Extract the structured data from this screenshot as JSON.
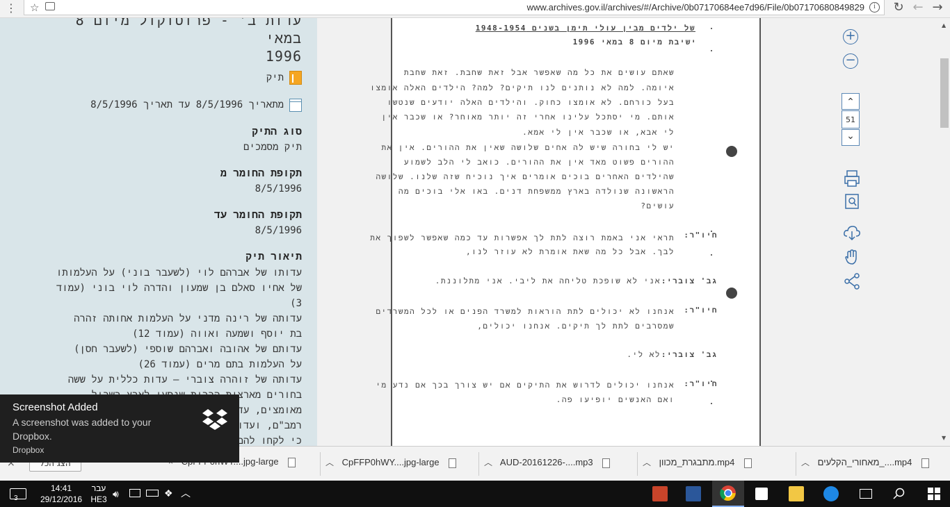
{
  "browser": {
    "url": "www.archives.gov.il/archives/#/Archive/0b07170684ee7d96/File/0b07170680849829",
    "menu_glyph": "⋮",
    "star_glyph": "☆",
    "info_glyph": "i",
    "reload_glyph": "↻",
    "back_glyph": "←",
    "forward_glyph": "→"
  },
  "left_panel": {
    "title_line1": "עדות ב' - פרוטוקול מיום 8 במאי",
    "title_line2": "1996",
    "type_label": "תיק",
    "date_range": "מתאריך 8/5/1996 עד תאריך 8/5/1996",
    "fields": [
      {
        "label": "סוג התיק",
        "value": "תיק מסמכים"
      },
      {
        "label": "תקופת החומר מ",
        "value": "8/5/1996"
      },
      {
        "label": "תקופת החומר עד",
        "value": "8/5/1996"
      }
    ],
    "description_label": "תיאור תיק",
    "description_lines": [
      "עדותו של אברהם לוי (לשעבר בוני) על העלמותו",
      "של אחיו סאלם בן שמעון והדרה לוי בוני (עמוד",
      "3)",
      "עדותה של רינה מדני על העלמות אחותה זהרה",
      "בת יוסף ושמעה ואווה (עמוד 12)",
      "עדותם של אהובה ואברהם שוספי (לשעבר חסן)",
      "על העלמות בתם מרים (עמוד 26)",
      "עדותה של זוהרה צוברי – עדות כללית על ששה",
      "בחורים מארצות הברית שנסעו לארץ בשביל",
      "מאומצים, עדות",
      "רמב\"ם, ועדות",
      "כי לקחו להם"
    ]
  },
  "document_page": {
    "header_line1": "של ילדים מבין עולי תימן בשנים 1948-1954",
    "header_line2": "ישיבת מיום 8 במאי 1996",
    "lines": [
      "שאתם עושים את כל מה שאפשר אבל זאת שחבת. זאת שחבת",
      "איומה. למה לא נותנים לנו תיקים? למה? הילדים האלה אומצו",
      "בעל כורחם. לא אומצו כחוק. והילדים האלה יודעים שנטשו",
      "אותם. מי יסתכל עלינו אחרי זה יותר מאוחר? או שכבר אין",
      "לי אבא, או שכבר אין לי אמא.",
      "יש לי בחורה שיש לה אחים שלושה שאין את ההורים. אין את",
      "ההורים פשוט מאד אין את ההורים. כואב לי הלב לשמוע",
      "שהילדים האחרים בוכים אומרים איך נוכיח שזה שלנו. שלושה",
      "הראשונה שנולדה בארץ ממשפחת דנים. באו אלי בוכים מה",
      "עושים?"
    ],
    "speaker1": "חיו\"ר:",
    "speaker1_line1": "תראי אני באמת רוצה לתת לך אפשרות עד כמה שאפשר לשפוך את",
    "speaker1_line2": "לבך. אבל כל מה שאת אומרת לא עוזר לנו,",
    "speaker2": "גב' צוברי:",
    "speaker2_line1": "אני לא שופכת טליחה את ליבי. אני מתלוננת.",
    "speaker3": "חיו\"ר:",
    "speaker3_line1": "אנחנו לא יכולים לתת הוראות למשרד הפנים או לכל המשרדים",
    "speaker3_line2": "שמסרבים לתת לך תיקים. אנחנו יכולים,",
    "speaker4": "גב' צוברי:",
    "speaker4_line1": "לא לי.",
    "speaker5": "חיו\"ר:",
    "speaker5_line1": "אנחנו יכולים לדרוש את התיקים אם יש צורך בכך אם נדע מי",
    "speaker5_line2": "ואם האנשים יופיעו פה."
  },
  "toolbar": {
    "page_number": "51",
    "zoom_in_glyph": "+",
    "zoom_out_glyph": "−",
    "up_glyph": "⌃",
    "down_glyph": "⌄"
  },
  "downloads": [
    {
      "name": "מאחורי_הקלעים_....mp4"
    },
    {
      "name": "מתבגרת_מכוון.mp4"
    },
    {
      "name": "AUD-20161226-....mp3"
    },
    {
      "name": "CpFFP0hWY....jpg-large"
    },
    {
      "name": "CpFFP0hWY....jpg-large"
    }
  ],
  "downloads_show_all": "הצג הכל",
  "downloads_close": "×",
  "notification": {
    "title": "Screenshot Added",
    "body": "A screenshot was added to your Dropbox.",
    "source": "Dropbox"
  },
  "taskbar": {
    "time": "14:41",
    "date": "29/12/2016",
    "lang_top": "עבר",
    "lang_bottom": "HE3",
    "badge": "3"
  },
  "colors": {
    "panel_bg": "#d9e5e9",
    "accent": "#3b6fa8",
    "folder": "#f5a623"
  }
}
